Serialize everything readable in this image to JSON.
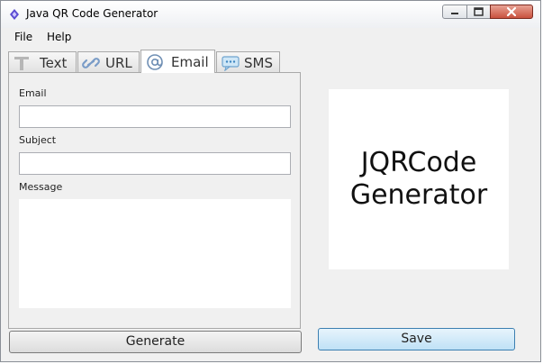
{
  "window": {
    "title": "Java QR Code Generator",
    "controls": {
      "minimize_icon": "minimize-icon",
      "maximize_icon": "maximize-icon",
      "close_icon": "close-icon"
    }
  },
  "menu": {
    "items": [
      {
        "label": "File"
      },
      {
        "label": "Help"
      }
    ]
  },
  "tabs": [
    {
      "label": "Text",
      "icon": "text-icon",
      "selected": false
    },
    {
      "label": "URL",
      "icon": "link-icon",
      "selected": false
    },
    {
      "label": "Email",
      "icon": "at-icon",
      "selected": true
    },
    {
      "label": "SMS",
      "icon": "chat-bubble-icon",
      "selected": false
    }
  ],
  "email_form": {
    "email_label": "Email",
    "email_value": "",
    "subject_label": "Subject",
    "subject_value": "",
    "message_label": "Message",
    "message_value": ""
  },
  "buttons": {
    "generate": "Generate",
    "save": "Save"
  },
  "preview": {
    "line1": "JQRCode",
    "line2": "Generator"
  },
  "colors": {
    "save_button": "#bfe1f6",
    "close_button": "#c9523f",
    "window_bg": "#f0f0f0"
  }
}
